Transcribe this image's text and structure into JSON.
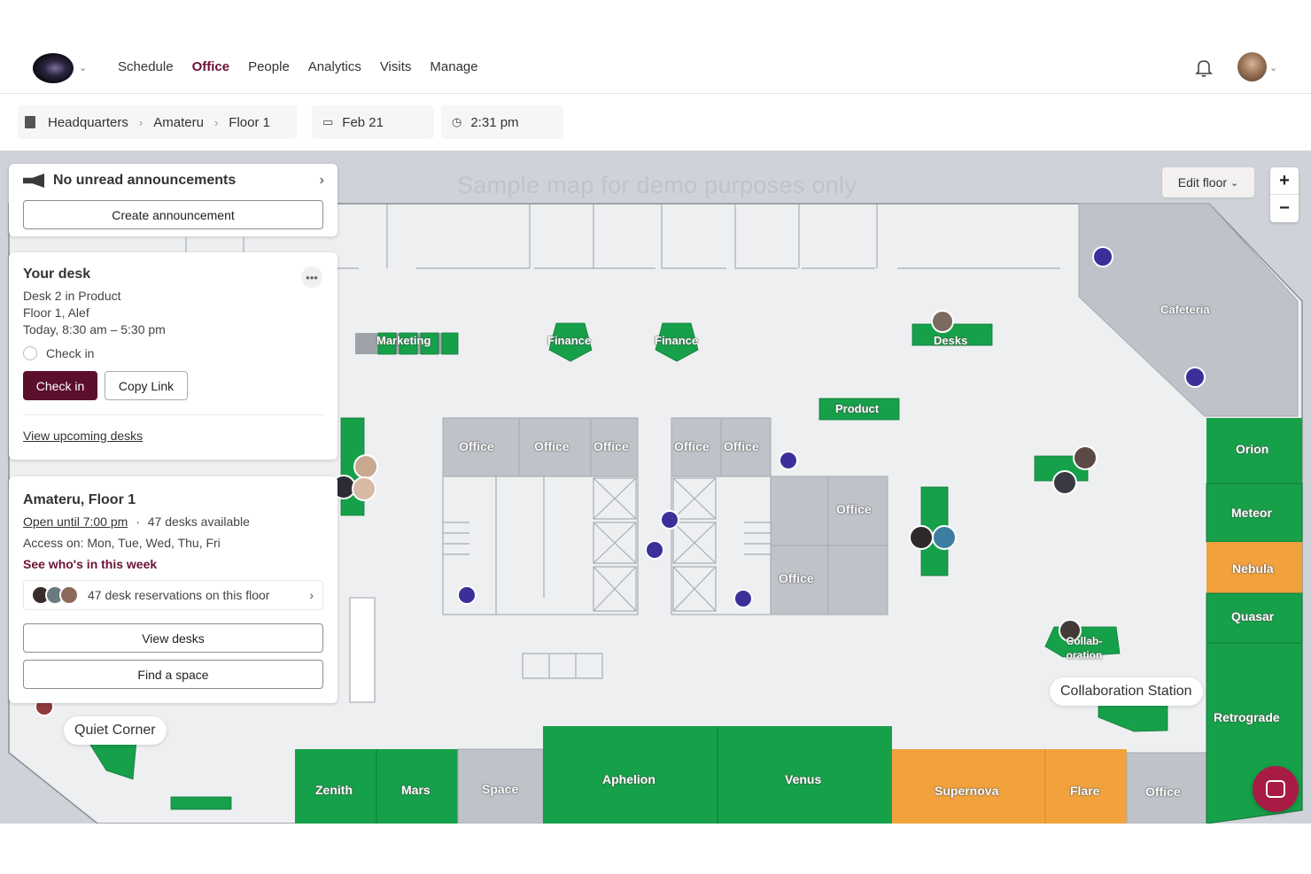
{
  "nav": {
    "items": [
      "Schedule",
      "Office",
      "People",
      "Analytics",
      "Visits",
      "Manage"
    ],
    "active": "Office"
  },
  "breadcrumb": {
    "building": "Headquarters",
    "area": "Amateru",
    "floor": "Floor 1"
  },
  "date": "Feb 21",
  "time": "2:31 pm",
  "map": {
    "watermark": "Sample map for demo purposes only",
    "edit_floor": "Edit floor",
    "zoom_in": "+",
    "zoom_out": "−",
    "labels": {
      "marketing": "Marketing",
      "finance1": "Finance",
      "finance2": "Finance",
      "desks": "Desks",
      "product": "Product",
      "cafeteria": "Cafeteria",
      "office1": "Office",
      "office2": "Office",
      "office3": "Office",
      "office4": "Office",
      "office5": "Office",
      "office6": "Office",
      "office7": "Office",
      "office8": "Office",
      "orion": "Orion",
      "meteor": "Meteor",
      "nebula": "Nebula",
      "quasar": "Quasar",
      "retrograde": "Retrograde",
      "zenith": "Zenith",
      "mars": "Mars",
      "space": "Space",
      "aphelion": "Aphelion",
      "venus": "Venus",
      "supernova": "Supernova",
      "flare": "Flare",
      "collab": "Collab-oration"
    },
    "tooltips": {
      "collab_station": "Collaboration Station",
      "quiet_corner": "Quiet Corner"
    },
    "colors": {
      "available": "#17a04a",
      "booked": "#f2a23c",
      "room": "#bfc3c9",
      "floor": "#eeeff1",
      "amenity": "#3d2f9a"
    }
  },
  "announcements": {
    "title": "No unread announcements",
    "create": "Create announcement"
  },
  "your_desk": {
    "title": "Your desk",
    "desk": "Desk 2 in Product",
    "floor": "Floor 1, Alef",
    "time": "Today, 8:30 am – 5:30 pm",
    "check_in_radio": "Check in",
    "check_in_button": "Check in",
    "copy_link": "Copy Link",
    "view_upcoming": "View upcoming desks"
  },
  "floor_info": {
    "title": "Amateru, Floor 1",
    "open_until": "Open until 7:00 pm",
    "separator": "·",
    "desks_available": "47 desks available",
    "access": "Access on: Mon, Tue, Wed, Thu, Fri",
    "see_who": "See who's in this week",
    "reservations": "47 desk reservations on this floor",
    "view_desks": "View desks",
    "find_space": "Find a space"
  }
}
